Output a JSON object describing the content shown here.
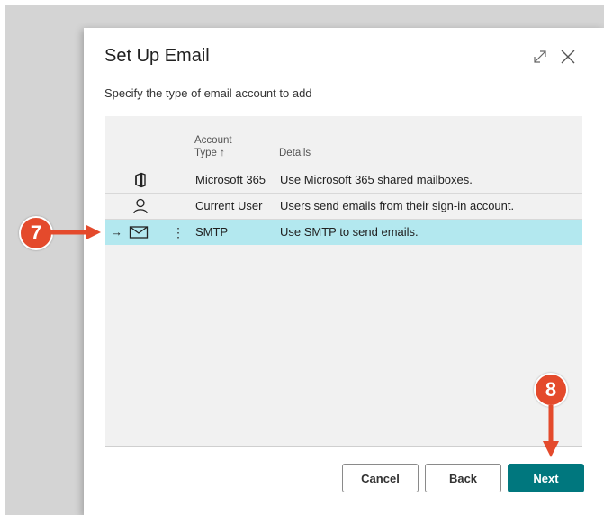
{
  "dialog": {
    "title": "Set Up Email",
    "subtitle": "Specify the type of email account to add"
  },
  "grid": {
    "columns": {
      "account_type_line1": "Account",
      "account_type_line2": "Type ↑",
      "details": "Details"
    },
    "rows": [
      {
        "icon": "office-icon",
        "type": "Microsoft 365",
        "details": "Use Microsoft 365 shared mailboxes."
      },
      {
        "icon": "user-icon",
        "type": "Current User",
        "details": "Users send emails from their sign-in account."
      },
      {
        "icon": "mail-icon",
        "type": "SMTP",
        "details": "Use SMTP to send emails.",
        "selected": true
      }
    ],
    "selected_arrow": "→",
    "row_menu": "⋮"
  },
  "buttons": {
    "cancel": "Cancel",
    "back": "Back",
    "next": "Next"
  },
  "annotations": {
    "step_select": "7",
    "step_next": "8"
  },
  "colors": {
    "accent": "#00777e",
    "selected_row": "#b3e8ef",
    "annotation": "#e44a2c"
  }
}
